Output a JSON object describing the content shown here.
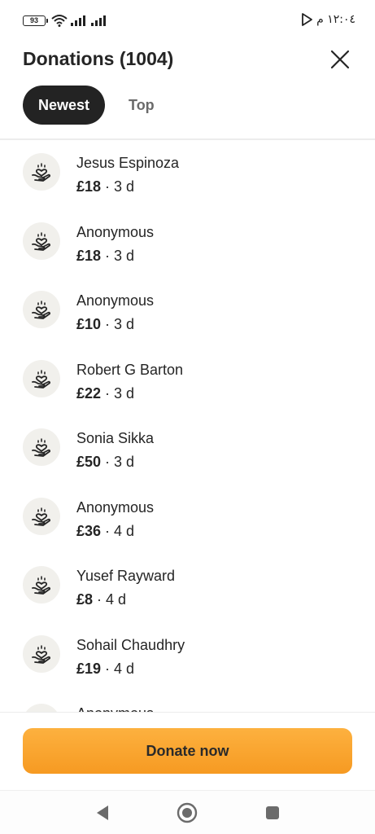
{
  "status_bar": {
    "battery": "93",
    "time": "١٢:٠٤ م"
  },
  "header": {
    "title": "Donations (1004)"
  },
  "tabs": [
    {
      "label": "Newest",
      "active": true
    },
    {
      "label": "Top",
      "active": false
    }
  ],
  "donations": [
    {
      "name": "Jesus Espinoza",
      "amount": "£18",
      "time": "3 d"
    },
    {
      "name": "Anonymous",
      "amount": "£18",
      "time": "3 d"
    },
    {
      "name": "Anonymous",
      "amount": "£10",
      "time": "3 d"
    },
    {
      "name": "Robert G Barton",
      "amount": "£22",
      "time": "3 d"
    },
    {
      "name": "Sonia Sikka",
      "amount": "£50",
      "time": "3 d"
    },
    {
      "name": "Anonymous",
      "amount": "£36",
      "time": "4 d"
    },
    {
      "name": "Yusef Rayward",
      "amount": "£8",
      "time": "4 d"
    },
    {
      "name": "Sohail Chaudhry",
      "amount": "£19",
      "time": "4 d"
    },
    {
      "name": "Anonymous",
      "amount": "",
      "time": ""
    }
  ],
  "separator": "·",
  "actions": {
    "donate_label": "Donate now"
  },
  "icons": {
    "close": "close-icon",
    "donation_avatar": "heart-in-hand-icon",
    "nav_back": "back-icon",
    "nav_home": "home-icon",
    "nav_recents": "recents-icon"
  },
  "colors": {
    "accent": "#f8a22c",
    "tab_active_bg": "#232323",
    "avatar_bg": "#f1f0ec"
  }
}
